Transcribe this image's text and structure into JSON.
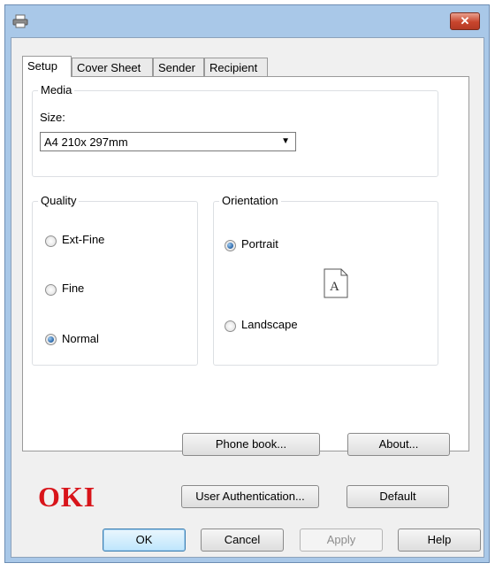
{
  "window": {
    "close_symbol": "✕",
    "title_icon": "printer-icon"
  },
  "tabs": [
    "Setup",
    "Cover Sheet",
    "Sender",
    "Recipient"
  ],
  "media": {
    "group_title": "Media",
    "size_label": "Size:",
    "size_value": "A4 210x 297mm"
  },
  "quality": {
    "group_title": "Quality",
    "options": [
      "Ext-Fine",
      "Fine",
      "Normal"
    ],
    "selected": "Normal"
  },
  "orientation": {
    "group_title": "Orientation",
    "options": [
      "Portrait",
      "Landscape"
    ],
    "selected": "Portrait",
    "preview_letter": "A"
  },
  "buttons": {
    "phone_book": "Phone book...",
    "about": "About...",
    "user_authentication": "User Authentication...",
    "default": "Default"
  },
  "logo": "OKI",
  "dialog_buttons": {
    "ok": "OK",
    "cancel": "Cancel",
    "apply": "Apply",
    "help": "Help"
  },
  "colors": {
    "logo": "#d8141a",
    "window_frame": "#a9c8e8",
    "close_button": "#c8452d"
  }
}
